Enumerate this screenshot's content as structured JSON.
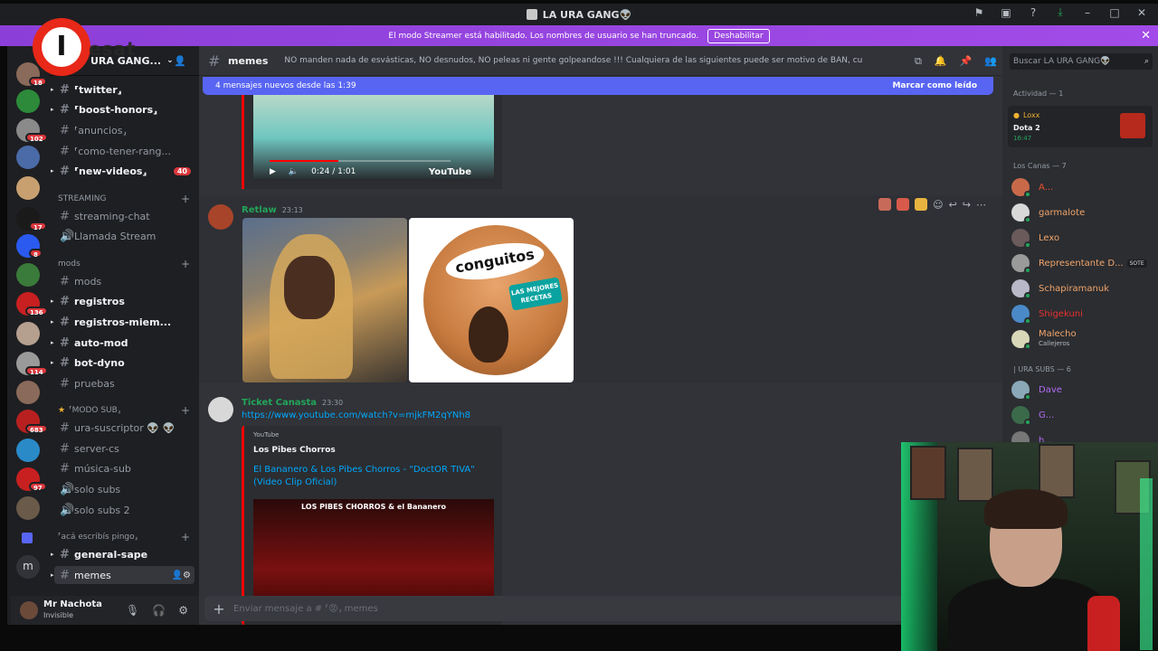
{
  "window": {
    "title": "LA URA GANG👽"
  },
  "banner": {
    "text": "El modo Streamer está habilitado. Los nombres de usuario se han truncado.",
    "button": "Deshabilitar",
    "close": "✕"
  },
  "server": {
    "name": "URA GANG..."
  },
  "channels": [
    {
      "label": "⸢twitter⸥",
      "bright": true
    },
    {
      "label": "⸢boost-honors⸥",
      "bright": true
    },
    {
      "label": "⸢anuncios⸥",
      "bright": false
    },
    {
      "label": "⸢como-tener-rang...",
      "bright": false
    },
    {
      "label": "⸢new-videos⸥",
      "bright": true,
      "badge": "40"
    }
  ],
  "categories": {
    "streaming": "STREAMING",
    "mods": "mods",
    "modo_sub": "⸢MODO SUB⸥",
    "acá": "⸢acá escribís pingo⸥"
  },
  "streaming_channels": [
    "streaming-chat",
    "Llamada Stream"
  ],
  "mod_channels": [
    "mods",
    "registros",
    "registros-miem...",
    "auto-mod",
    "bot-dyno",
    "pruebas"
  ],
  "sub_channels": [
    "ura-suscriptor 👽 👽",
    "server-cs",
    "música-sub",
    "solo subs",
    "solo subs 2"
  ],
  "last_channels": [
    "general-sape",
    "memes"
  ],
  "user": {
    "name": "Mr Nachota",
    "status": "Invisible"
  },
  "channel_header": {
    "name": "memes",
    "topic": "NO manden nada de esvásticas, NO desnudos, NO peleas ni gente golpeandose !!! Cualquiera de las siguientes puede ser motivo de BAN, cuiden el stream!"
  },
  "search": {
    "placeholder": "Buscar LA URA GANG👽"
  },
  "newbar": {
    "text": "4 mensajes nuevos desde las 1:39",
    "mark": "Marcar como leído"
  },
  "video": {
    "time": "0:24 / 1:01",
    "brand": "YouTube",
    "progress": 0.38
  },
  "messages": [
    {
      "author": "Retlaw",
      "time": "23:13",
      "color": "#23a55a"
    },
    {
      "author": "Ticket Canasta",
      "time": "23:30",
      "color": "#23a55a",
      "link": "https://www.youtube.com/watch?v=mjkFM2qYNh8"
    }
  ],
  "image2_text": {
    "logo": "conguitos",
    "label": "LAS MEJORES RECETAS"
  },
  "embed": {
    "provider": "YouTube",
    "author": "Los Pibes Chorros",
    "title": "El Bananero & Los Pibes Chorros - \"DoctOR TIVA\" (Video Clip Oficial)",
    "thumb_text": "LOS PIBES CHORROS & el Bananero"
  },
  "composer": {
    "placeholder": "Enviar mensaje a # ⸢😡⸥ memes"
  },
  "activity": {
    "header": "Actividad — 1",
    "user": "Loxx",
    "game": "Dota 2",
    "time": "16:47"
  },
  "member_groups": [
    {
      "label": "Los Canas — 7"
    },
    {
      "label": "| URA SUBS — 6"
    }
  ],
  "members": [
    {
      "name": "A...",
      "color": "#e8522e"
    },
    {
      "name": "garmalote",
      "color": "#f2a56b"
    },
    {
      "name": "Lexo",
      "color": "#f2a56b"
    },
    {
      "name": "Representante D...",
      "color": "#f2a56b",
      "tag": "SOTE"
    },
    {
      "name": "Schapiramanuk",
      "color": "#f2a56b"
    },
    {
      "name": "Shigekuni",
      "color": "#e8322e"
    },
    {
      "name": "Malecho",
      "color": "#f2a56b",
      "sub": "Callejeros"
    },
    {
      "name": "Dave",
      "color": "#b36bf2"
    },
    {
      "name": "G...",
      "color": "#b36bf2"
    },
    {
      "name": "h...",
      "color": "#b36bf2"
    }
  ],
  "colors": {
    "accent": "#5865f2",
    "banner": "#a24be8",
    "online": "#23a55a",
    "link": "#00a8fc"
  },
  "logo": {
    "letter": "I",
    "wordmark": "esat"
  },
  "rail": {
    "dm_letter": "m",
    "badges": [
      "18",
      "102",
      "8",
      "17",
      "8",
      "136",
      "114",
      "683",
      "97"
    ]
  }
}
